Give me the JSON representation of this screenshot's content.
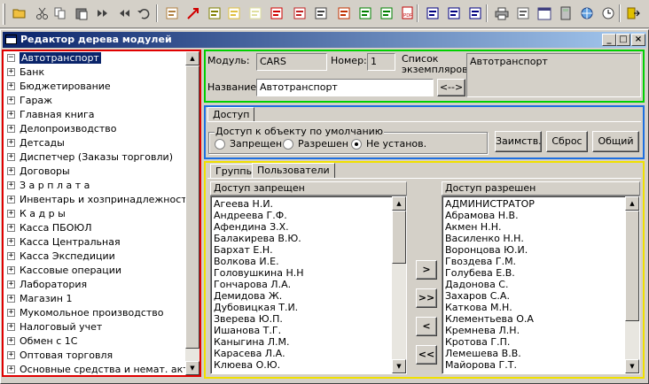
{
  "window": {
    "title": "Редактор дерева модулей",
    "controls": {
      "minimize": "_",
      "maximize": "□",
      "close": "×"
    }
  },
  "toolbar": {
    "icons": [
      "open-folder-icon",
      "cut-icon",
      "copy-icon",
      "paste-icon",
      "fast-forward-icon",
      "rewind-icon",
      "undo-icon",
      "edit-doc-icon",
      "red-arrow-icon",
      "report-icon",
      "new-doc-icon",
      "doc-icon",
      "pointer-arrow-icon",
      "export-icon",
      "print-doc-icon",
      "import-icon",
      "excel-icon",
      "excel-export-icon",
      "pdf-icon",
      "cascade-windows-icon",
      "tile-horizontal-icon",
      "tile-vertical-icon",
      "printer-icon",
      "page-icon",
      "calendar-icon",
      "calculator-icon",
      "globe-icon",
      "clock-icon",
      "exit-icon"
    ]
  },
  "tree": {
    "items": [
      {
        "label": "Автотранспорт",
        "expander": "−",
        "selected": true
      },
      {
        "label": "Банк",
        "expander": "+"
      },
      {
        "label": "Бюджетирование",
        "expander": "+"
      },
      {
        "label": "Гараж",
        "expander": "+"
      },
      {
        "label": "Главная книга",
        "expander": "+"
      },
      {
        "label": "Делопроизводство",
        "expander": "+"
      },
      {
        "label": "Детсады",
        "expander": "+"
      },
      {
        "label": "Диспетчер (Заказы торговли)",
        "expander": "+"
      },
      {
        "label": "Договоры",
        "expander": "+"
      },
      {
        "label": "З а р п л а т а",
        "expander": "+"
      },
      {
        "label": "Инвентарь и хозпринадлежности",
        "expander": "+"
      },
      {
        "label": "К а д р ы",
        "expander": "+"
      },
      {
        "label": "Касса ПБОЮЛ",
        "expander": "+"
      },
      {
        "label": "Касса Центральная",
        "expander": "+"
      },
      {
        "label": "Касса Экспедиции",
        "expander": "+"
      },
      {
        "label": "Кассовые операции",
        "expander": "+"
      },
      {
        "label": "Лаборатория",
        "expander": "+"
      },
      {
        "label": "Магазин 1",
        "expander": "+"
      },
      {
        "label": "Мукомольное производство",
        "expander": "+"
      },
      {
        "label": "Налоговый учет",
        "expander": "+"
      },
      {
        "label": "Обмен с 1С",
        "expander": "+"
      },
      {
        "label": "Оптовая торговля",
        "expander": "+"
      },
      {
        "label": "Основные средства и немат. акт",
        "expander": "+"
      }
    ]
  },
  "module": {
    "module_label": "Модуль:",
    "module_value": "CARS",
    "number_label": "Номер:",
    "number_value": "1",
    "instances_label_line1": "Список",
    "instances_label_line2": "экземпляров:",
    "instances_value": "Автотранспорт",
    "name_label": "Название:",
    "name_value": "Автотранспорт",
    "swap_button": "<-->"
  },
  "access": {
    "tab": "Доступ",
    "group_title": "Доступ к объекту по умолчанию",
    "radios": [
      {
        "label": "Запрещен",
        "checked": false
      },
      {
        "label": "Разрешен",
        "checked": false
      },
      {
        "label": "Не установ.",
        "checked": true
      }
    ],
    "buttons": {
      "borrow": "Заимств.",
      "reset": "Сброс",
      "common": "Общий"
    }
  },
  "users": {
    "tabs": [
      "Группы",
      "Пользователи"
    ],
    "active_tab": "Пользователи",
    "denied_header": "Доступ запрещен",
    "allowed_header": "Доступ разрешен",
    "denied": [
      "Агеева Н.И.",
      "Андреева Г.Ф.",
      "Афендина З.Х.",
      "Балакирева В.Ю.",
      "Бархат Е.Н.",
      "Волкова И.Е.",
      "Головушкина Н.Н",
      "Гончарова Л.А.",
      "Демидова Ж.",
      "Дубовицкая Т.И.",
      "Зверева Ю.П.",
      "Ишанова Т.Г.",
      "Каныгина Л.М.",
      "Карасева Л.А.",
      "Клюева О.Ю."
    ],
    "allowed": [
      "АДМИНИСТРАТОР",
      "Абрамова Н.В.",
      "Акмен Н.Н.",
      "Василенко Н.Н.",
      "Воронцова Ю.И.",
      "Гвоздева Г.М.",
      "Голубева Е.В.",
      "Дадонова С.",
      "Захаров С.А.",
      "Каткова М.Н.",
      "Клементьева О.А",
      "Кремнева Л.Н.",
      "Кротова Г.П.",
      "Лемешева В.В.",
      "Майорова Г.Т."
    ],
    "move_buttons": {
      "add": ">",
      "add_all": ">>",
      "remove": "<",
      "remove_all": "<<"
    }
  }
}
